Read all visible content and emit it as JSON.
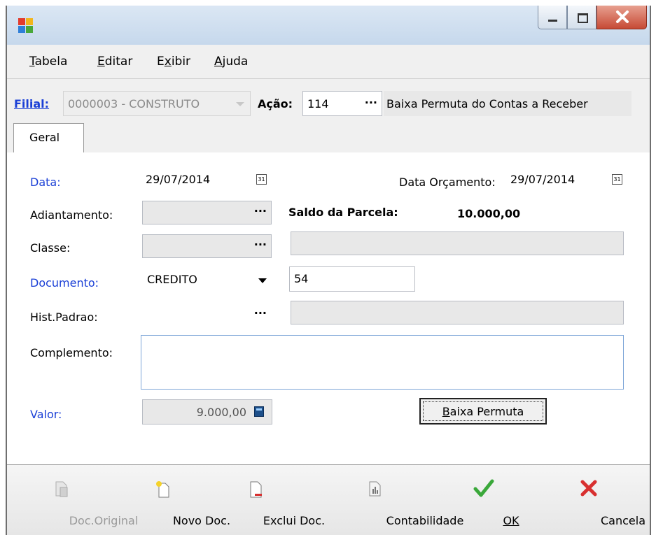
{
  "window": {
    "title": ""
  },
  "menu": [
    {
      "label": "Tabela",
      "accel": "T",
      "rest": "abela"
    },
    {
      "label": "Editar",
      "accel": "E",
      "rest": "ditar"
    },
    {
      "label": "Exibir",
      "pre": "E",
      "accel": "x",
      "rest": "ibir"
    },
    {
      "label": "Ajuda",
      "accel": "A",
      "rest": "juda"
    }
  ],
  "header": {
    "filial_label": "Filial:",
    "filial_value": "0000003 - CONSTRUTO",
    "acao_label": "Ação:",
    "acao_code": "114",
    "acao_desc": "Baixa Permuta do Contas a Receber"
  },
  "tabs": [
    {
      "label": "Geral"
    }
  ],
  "form": {
    "data_label": "Data:",
    "data_value": "29/07/2014",
    "data_orcamento_label": "Data Orçamento:",
    "data_orcamento_value": "29/07/2014",
    "adiantamento_label": "Adiantamento:",
    "saldo_label": "Saldo da Parcela:",
    "saldo_value": "10.000,00",
    "classe_label": "Classe:",
    "documento_label": "Documento:",
    "documento_value": "CREDITO",
    "documento_number": "54",
    "hist_label": "Hist.Padrao:",
    "complemento_label": "Complemento:",
    "valor_label": "Valor:",
    "valor_value": "9.000,00",
    "baixa_button": "Baixa Permuta",
    "baixa_accel": "B",
    "baixa_rest": "aixa Permuta",
    "ellipsis": "···",
    "cal_glyph": "31"
  },
  "toolbar": [
    {
      "label": "Doc.Original",
      "icon": "doc-original-icon",
      "enabled": false
    },
    {
      "label": "Novo Doc.",
      "icon": "new-doc-icon",
      "enabled": true
    },
    {
      "label": "Exclui Doc.",
      "icon": "delete-doc-icon",
      "enabled": true
    },
    {
      "label": "Contabilidade",
      "icon": "accounting-icon",
      "enabled": true
    },
    {
      "label": "OK",
      "icon": "check-icon",
      "enabled": true
    },
    {
      "label": "Cancela",
      "icon": "cancel-icon",
      "enabled": true
    }
  ],
  "colors": {
    "blue_label": "#1a3fd6",
    "ok_green": "#3aa83a",
    "cancel_red": "#d83030",
    "close_red": "#c64a35"
  }
}
